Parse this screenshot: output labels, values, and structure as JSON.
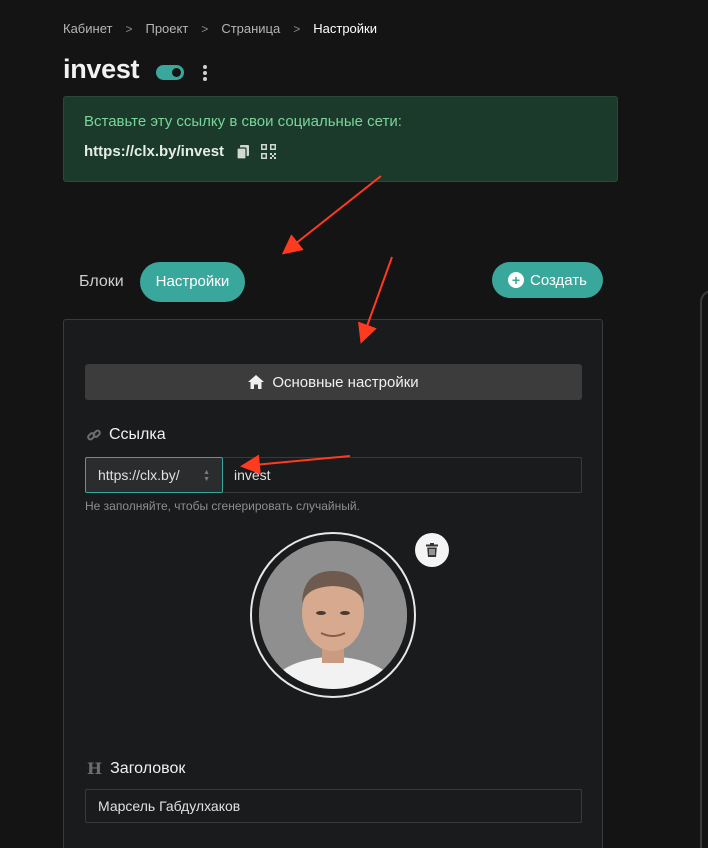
{
  "breadcrumb": {
    "items": [
      "Кабинет",
      "Проект",
      "Страница"
    ],
    "current": "Настройки",
    "separator": ">"
  },
  "page": {
    "title": "invest",
    "published_toggle": true
  },
  "share": {
    "hint": "Вставьте эту ссылку в свои социальные сети:",
    "link": "https://clx.by/invest",
    "icons": [
      "copy-icon",
      "qr-code-icon"
    ]
  },
  "tabs": {
    "blocks_label": "Блоки",
    "settings_label": "Настройки",
    "active": "settings"
  },
  "create_button": {
    "label": "Создать",
    "icon": "plus-circle-icon"
  },
  "settings": {
    "section_title": "Основные настройки",
    "section_icon": "home-icon",
    "link_field": {
      "label": "Ссылка",
      "icon": "link-icon",
      "domain": "https://clx.by/",
      "slug": "invest",
      "helper": "Не заполняйте, чтобы сгенерировать случайный."
    },
    "avatar": {
      "delete_icon": "trash-icon"
    },
    "title_field": {
      "label": "Заголовок",
      "icon": "heading-icon",
      "value": "Марсель Габдулхаков"
    }
  },
  "colors": {
    "background": "#141414",
    "accent": "#3aa79c",
    "share_box": "#1c3a2b",
    "share_hint": "#79d698",
    "panel": "#1a1b1d",
    "annotation_arrow": "#ff3b1f"
  }
}
